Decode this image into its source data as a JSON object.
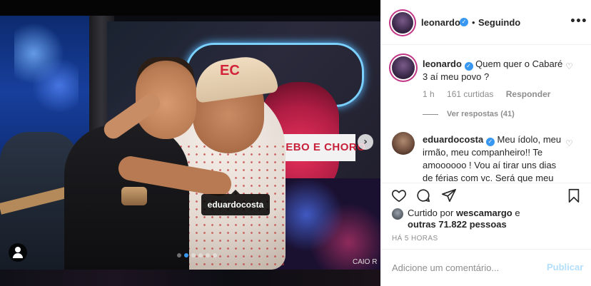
{
  "photo": {
    "tag_label": "eduardocosta",
    "banner_text": "CANTO, BEBO E CHORO",
    "cap_logo": "EC",
    "credit": "CAIO R",
    "carousel_dots": 6,
    "active_dot": 1
  },
  "header": {
    "username": "leonardo",
    "separator": "•",
    "follow_label": "Seguindo",
    "more_label": "•••"
  },
  "comments": [
    {
      "username": "leonardo",
      "text": "Quem quer o Cabaré 3 aí meu povo ?",
      "time": "1 h",
      "likes": "161 curtidas",
      "reply_label": "Responder",
      "view_replies": "Ver respostas (41)"
    },
    {
      "username": "eduardocosta",
      "text": "Meu ídolo, meu irmão, meu companheiro!! Te amoooooo ! Vou aí tirar uns dias de férias com vc. Será que meu"
    }
  ],
  "likes": {
    "prefix": "Curtido por",
    "user": "wescamargo",
    "suffix": "e",
    "others": "outras 71.822 pessoas"
  },
  "timestamp": "HÁ 5 HORAS",
  "add_comment": {
    "placeholder": "Adicione um comentário...",
    "publish_label": "Publicar"
  },
  "colors": {
    "verified": "#3897f0",
    "publish_disabled": "#b2dffc",
    "story_ring": "#c13584"
  },
  "icons": {
    "like": "heart-outline",
    "comment": "speech-bubble",
    "share": "paper-plane",
    "save": "bookmark"
  }
}
